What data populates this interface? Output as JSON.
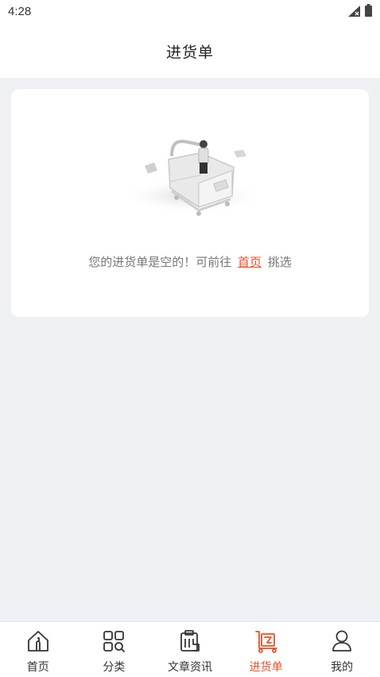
{
  "status_bar": {
    "time": "4:28",
    "icons": [
      "signal-icon",
      "battery-icon"
    ]
  },
  "header": {
    "title": "进货单"
  },
  "empty_state": {
    "illustration": "empty-cart-illustration",
    "message_prefix": "您的进货单是空的！可前往",
    "link_label": "首页",
    "message_suffix": "挑选"
  },
  "bottom_nav": {
    "items": [
      {
        "label": "首页",
        "icon": "home-icon"
      },
      {
        "label": "分类",
        "icon": "category-icon"
      },
      {
        "label": "文章资讯",
        "icon": "article-icon"
      },
      {
        "label": "进货单",
        "icon": "cart-icon"
      },
      {
        "label": "我的",
        "icon": "user-icon"
      }
    ],
    "active": "进货单"
  },
  "colors": {
    "accent": "#e8502a",
    "background": "#eff0f4"
  }
}
